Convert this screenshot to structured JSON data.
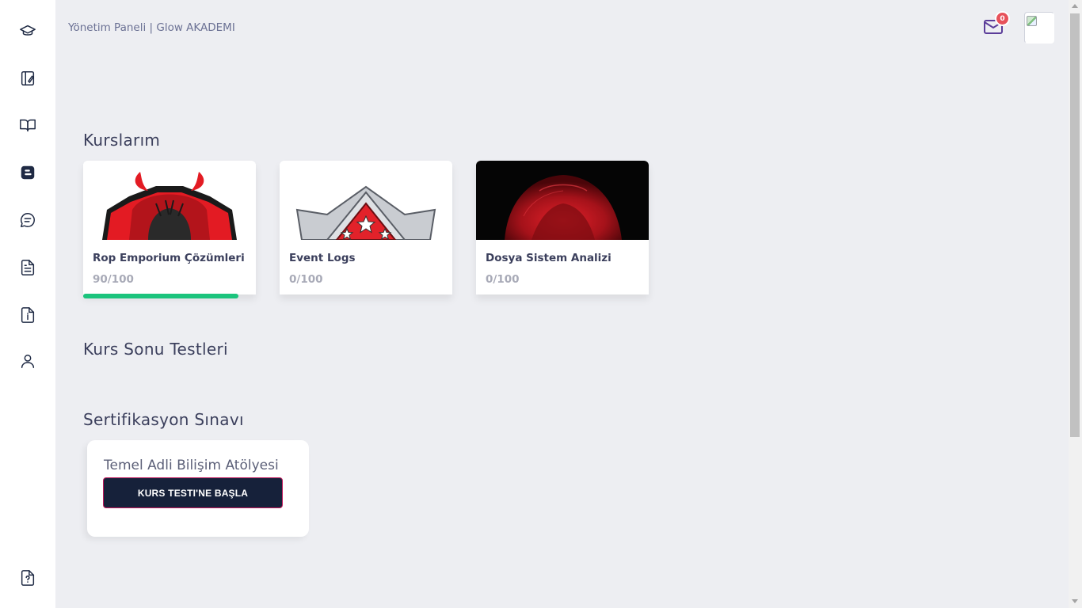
{
  "header": {
    "title": "Yönetim Paneli | Glow AKADEMI",
    "mail_badge": "0"
  },
  "sidebar": {
    "items": [
      {
        "icon": "graduation-cap-icon"
      },
      {
        "icon": "edit-book-icon"
      },
      {
        "icon": "book-open-icon"
      },
      {
        "icon": "blogger-icon"
      },
      {
        "icon": "chat-icon"
      },
      {
        "icon": "document-icon"
      },
      {
        "icon": "info-file-icon"
      },
      {
        "icon": "user-icon"
      }
    ],
    "bottom_icon": "help-file-icon"
  },
  "courses": {
    "title": "Kurslarım",
    "items": [
      {
        "name": "Rop Emporium Çözümleri",
        "score": "90/100",
        "progress": 0.9
      },
      {
        "name": "Event Logs",
        "score": "0/100",
        "progress": 0
      },
      {
        "name": "Dosya Sistem Analizi",
        "score": "0/100",
        "progress": 0
      }
    ]
  },
  "tests": {
    "title": "Kurs Sonu Testleri"
  },
  "certification": {
    "title": "Sertifikasyon Sınavı",
    "card_title": "Temel Adli Bilişim Atölyesi",
    "button": "KURS TESTI'NE BAŞLA"
  },
  "colors": {
    "accent": "#5b3c99",
    "progress": "#1bc47d",
    "button_bg": "#16213a",
    "badge": "#e7515a"
  }
}
